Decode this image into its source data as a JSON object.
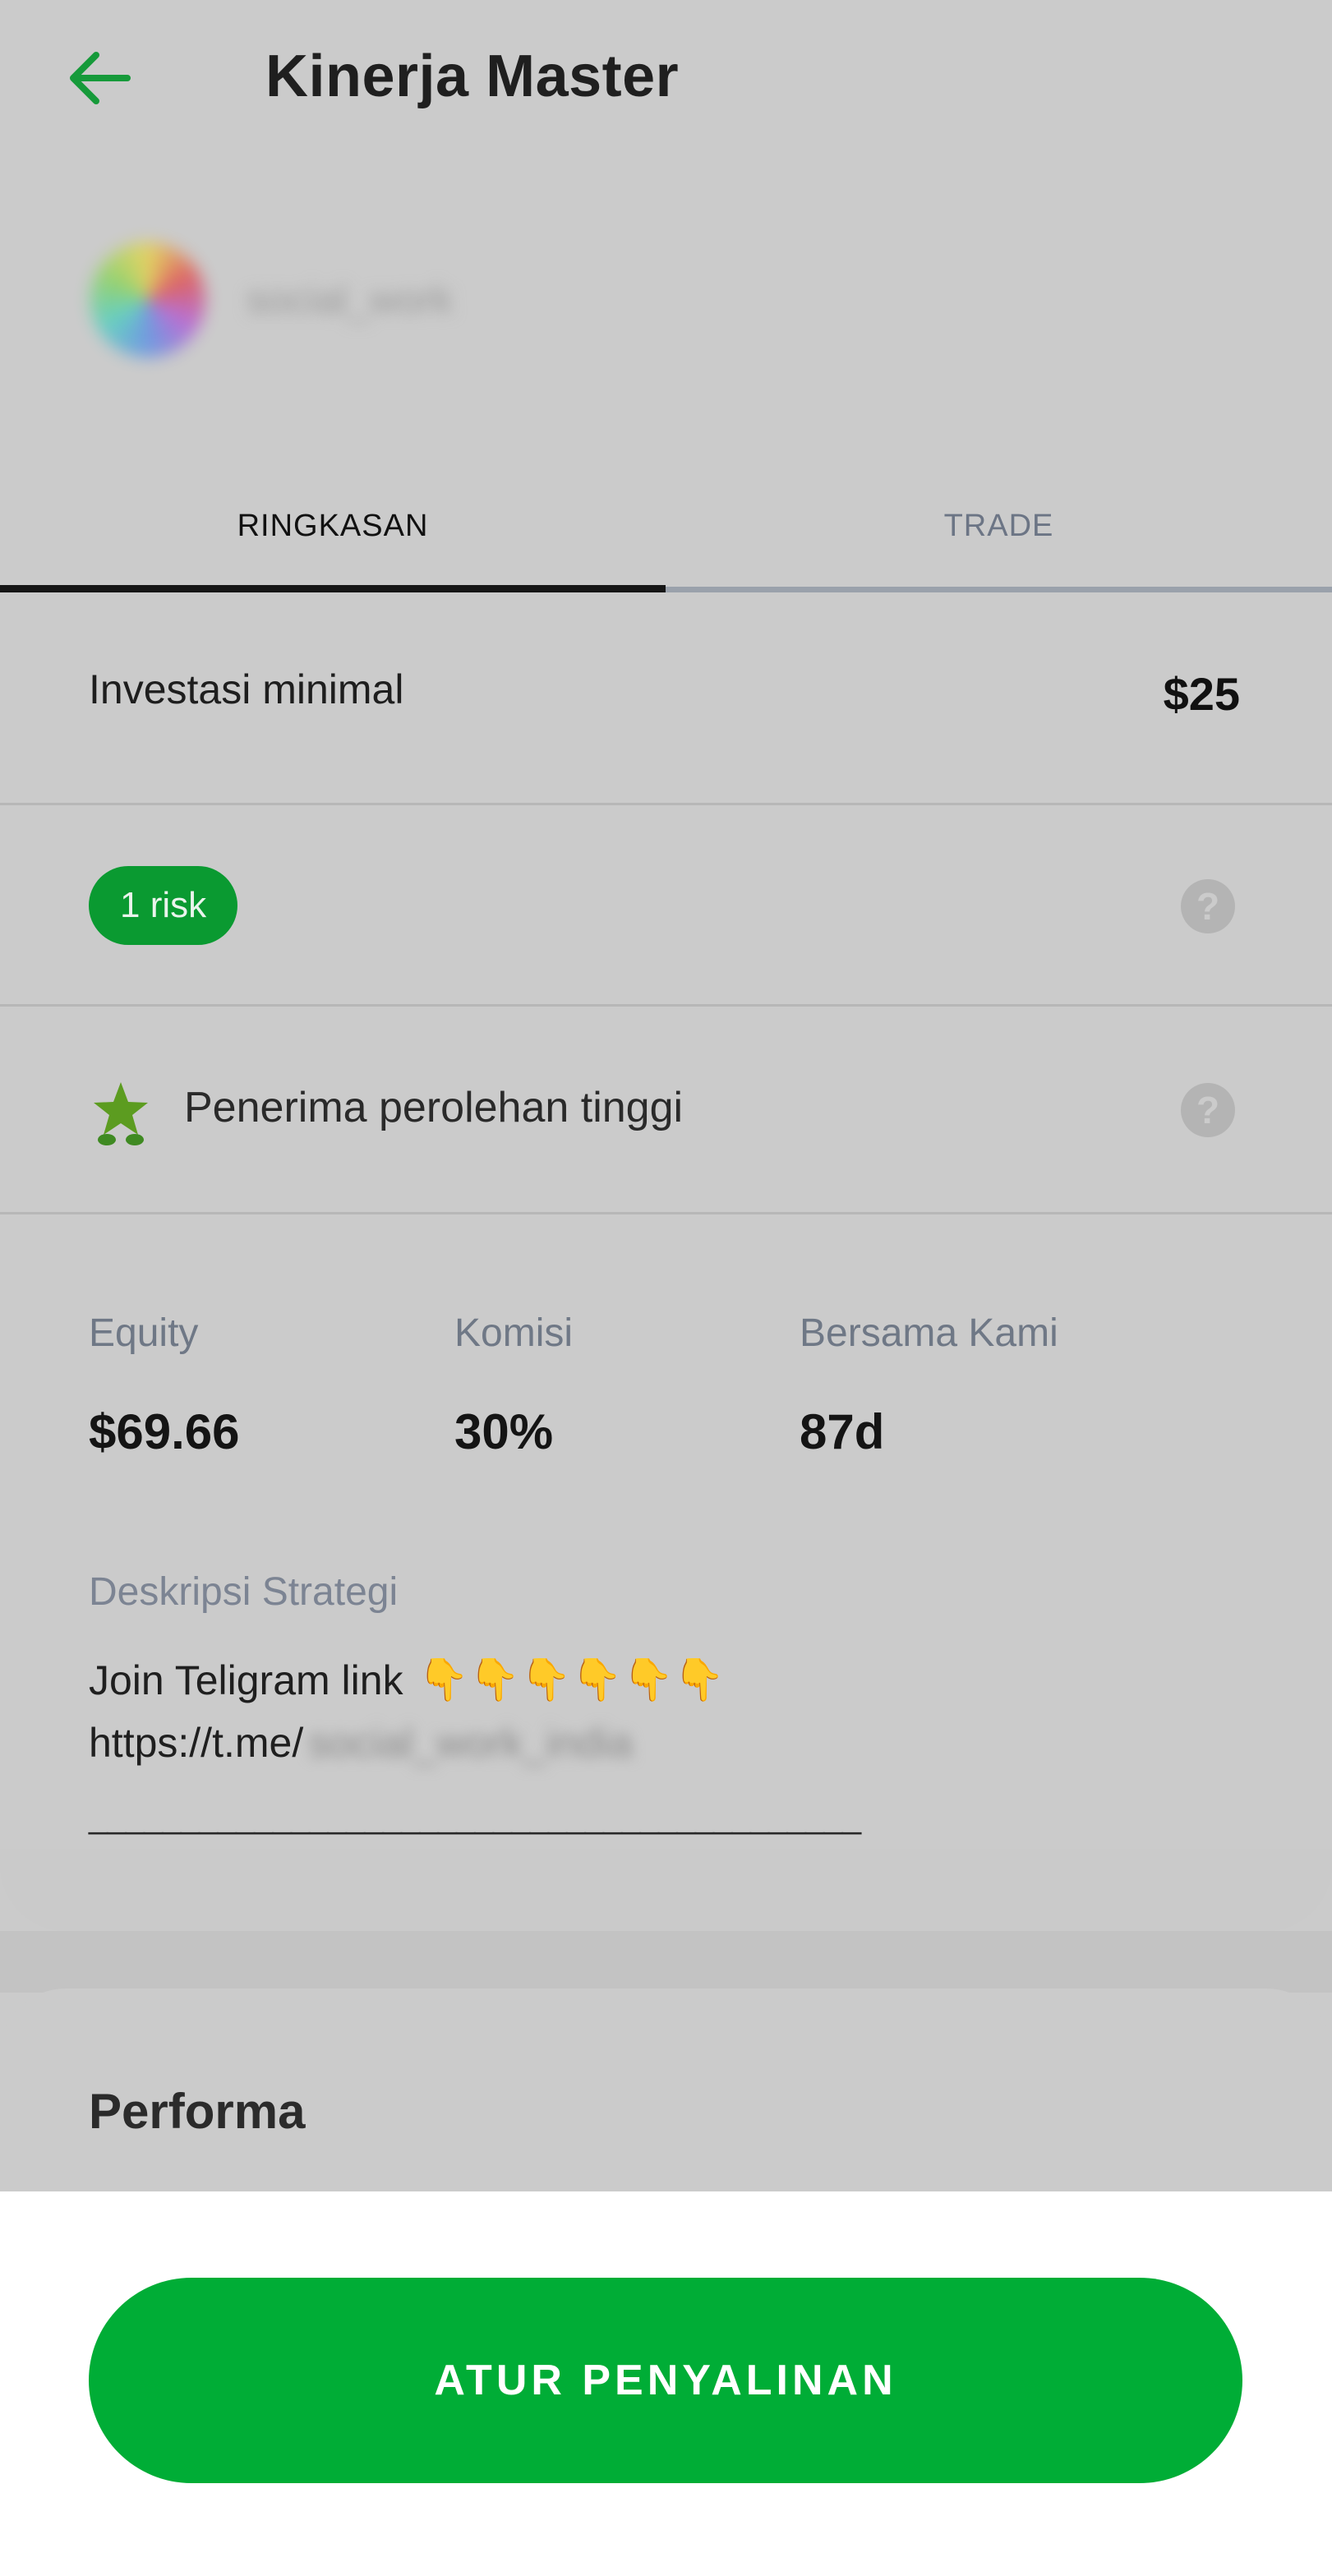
{
  "header": {
    "title": "Kinerja Master",
    "back_icon": "arrow-left-icon"
  },
  "profile": {
    "name": "social_work"
  },
  "tabs": [
    {
      "label": "RINGKASAN",
      "active": true
    },
    {
      "label": "TRADE",
      "active": false
    }
  ],
  "summary": {
    "min_investment_label": "Investasi minimal",
    "min_investment_value": "$25",
    "risk_badge": "1 risk",
    "high_earner_label": "Penerima perolehan tinggi",
    "help_icon_glyph": "?",
    "stats": [
      {
        "label": "Equity",
        "value": "$69.66"
      },
      {
        "label": "Komisi",
        "value": "30%"
      },
      {
        "label": "Bersama Kami",
        "value": "87d"
      }
    ],
    "strategy_label": "Deskripsi Strategi",
    "strategy_line1": "Join Teligram link",
    "strategy_emojis": "👇👇👇👇👇👇",
    "strategy_link_prefix": "https://t.me/",
    "strategy_link_handle": "social_work_india",
    "strategy_separator": "__________________________________________"
  },
  "performance": {
    "title": "Performa"
  },
  "actions": {
    "copy_button": "ATUR PENYALINAN"
  },
  "colors": {
    "accent_green": "#00ad36",
    "badge_green": "#0a9a31",
    "overlay_gray": "#cbcbcb"
  }
}
